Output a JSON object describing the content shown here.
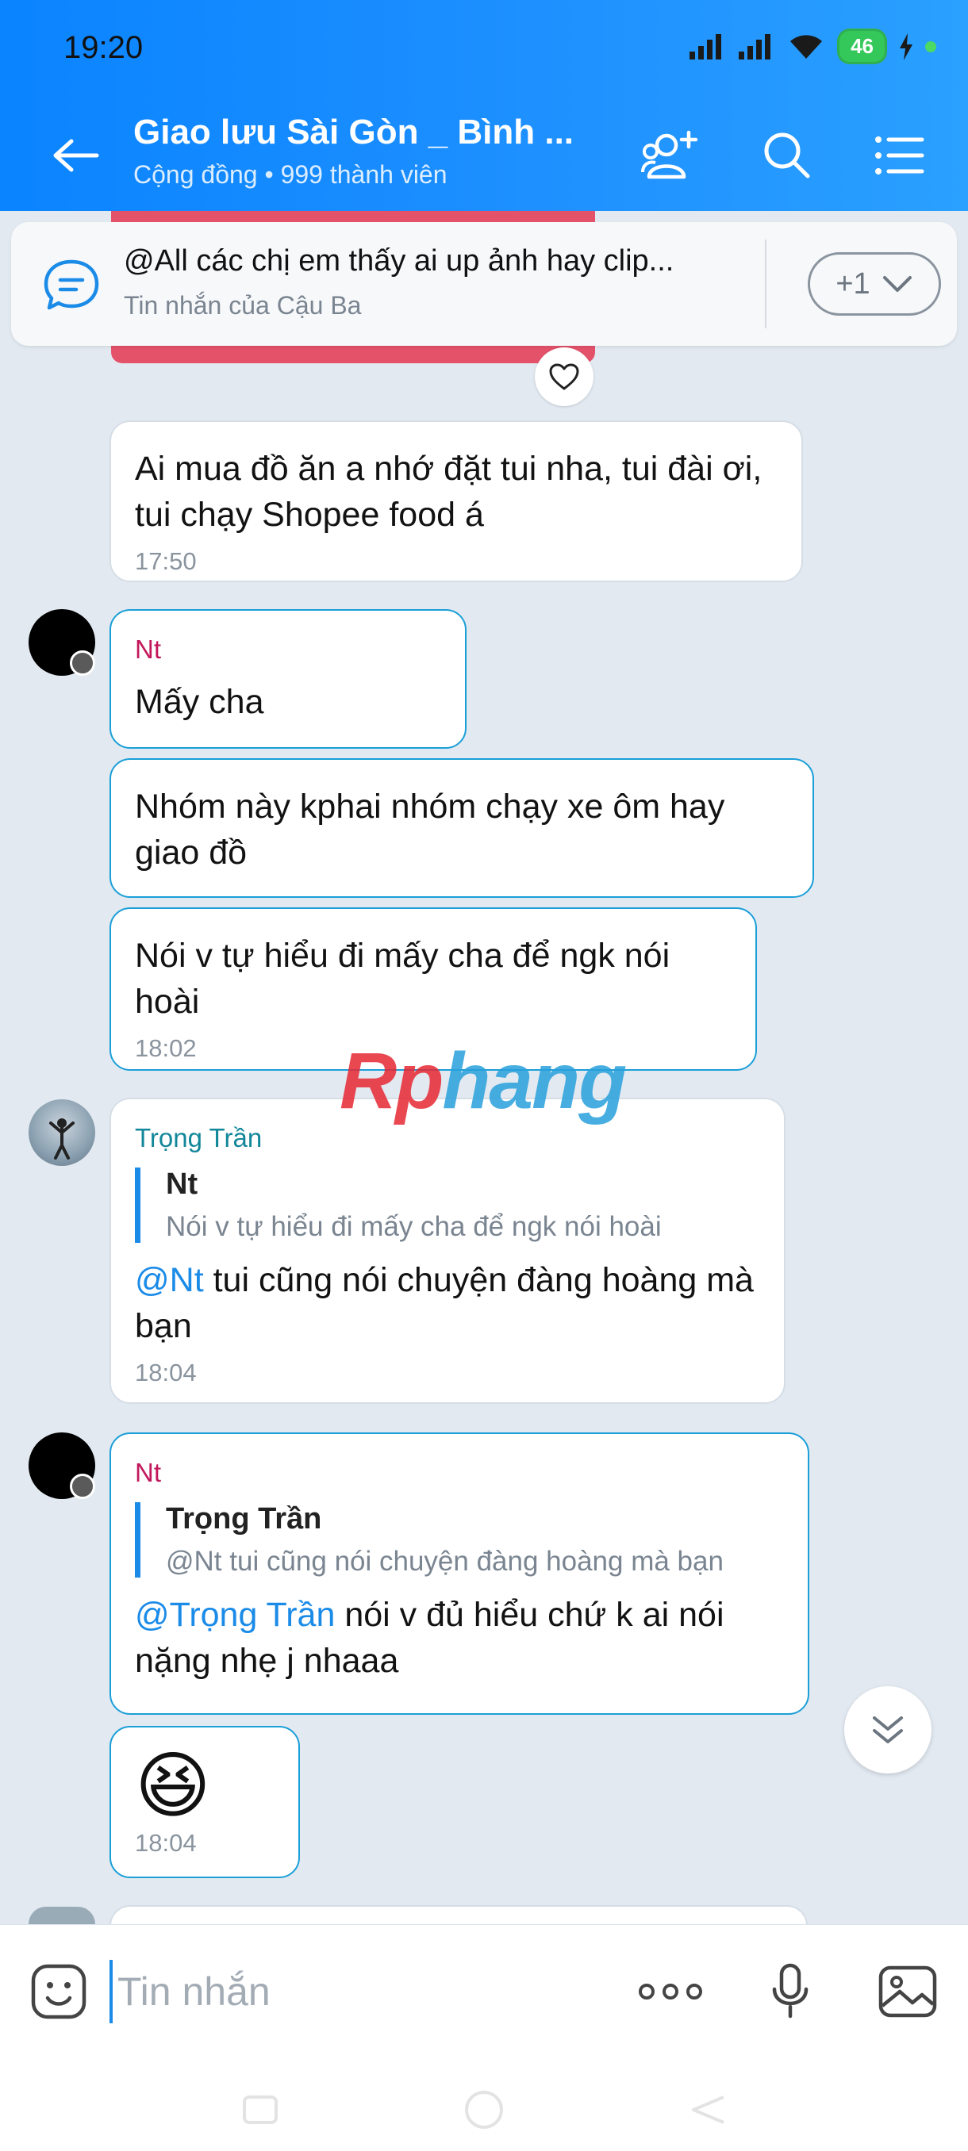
{
  "status_bar": {
    "time": "19:20",
    "battery": "46"
  },
  "header": {
    "title": "Giao lưu Sài Gòn _ Bình ...",
    "subtitle": "Cộng đồng • 999 thành viên"
  },
  "pinned": {
    "message": "@All các chị em thấy ai up ảnh hay clip...",
    "from": "Tin nhắn của Cậu Ba",
    "more_label": "+1"
  },
  "messages": [
    {
      "text": "Ai mua đồ ăn a nhớ đặt tui nha, tui đài ơi, tui chạy Shopee food á",
      "time": "17:50"
    },
    {
      "sender": "Nt",
      "text": "Mấy cha"
    },
    {
      "text": "Nhóm này kphai nhóm chạy xe ôm hay giao đồ"
    },
    {
      "text": "Nói v tự hiểu đi mấy cha để ngk nói hoài",
      "time": "18:02"
    },
    {
      "sender": "Trọng Trần",
      "quote": {
        "name": "Nt",
        "text": "Nói v tự hiểu đi mấy cha để ngk nói hoài"
      },
      "mention": "@Nt",
      "text": " tui cũng nói chuyện đàng hoàng mà bạn",
      "time": "18:04"
    },
    {
      "sender": "Nt",
      "quote": {
        "name": "Trọng Trần",
        "text": "@Nt tui cũng nói chuyện đàng hoàng mà bạn"
      },
      "mention": "@Trọng Trần",
      "text": " nói v đủ hiểu chứ k ai nói nặng nhẹ j nhaaa"
    },
    {
      "emoji": "😆",
      "time": "18:04"
    }
  ],
  "watermark": {
    "part1": "Rp",
    "part2": "hang"
  },
  "composer": {
    "placeholder": "Tin nhắn"
  },
  "icons": {
    "back": "arrow-left-icon",
    "add_member": "add-member-icon",
    "search": "search-icon",
    "menu": "menu-icon",
    "pinned": "chat-bubble-icon",
    "heart": "heart-icon",
    "scroll": "double-chevron-down-icon",
    "sticker": "sticker-icon",
    "more": "more-dots-icon",
    "mic": "mic-icon",
    "gallery": "image-icon"
  },
  "colors": {
    "accent": "#1b8be8",
    "header": "#1e90ff",
    "sender_nt": "#c2185b",
    "sender_trong": "#13879a"
  }
}
